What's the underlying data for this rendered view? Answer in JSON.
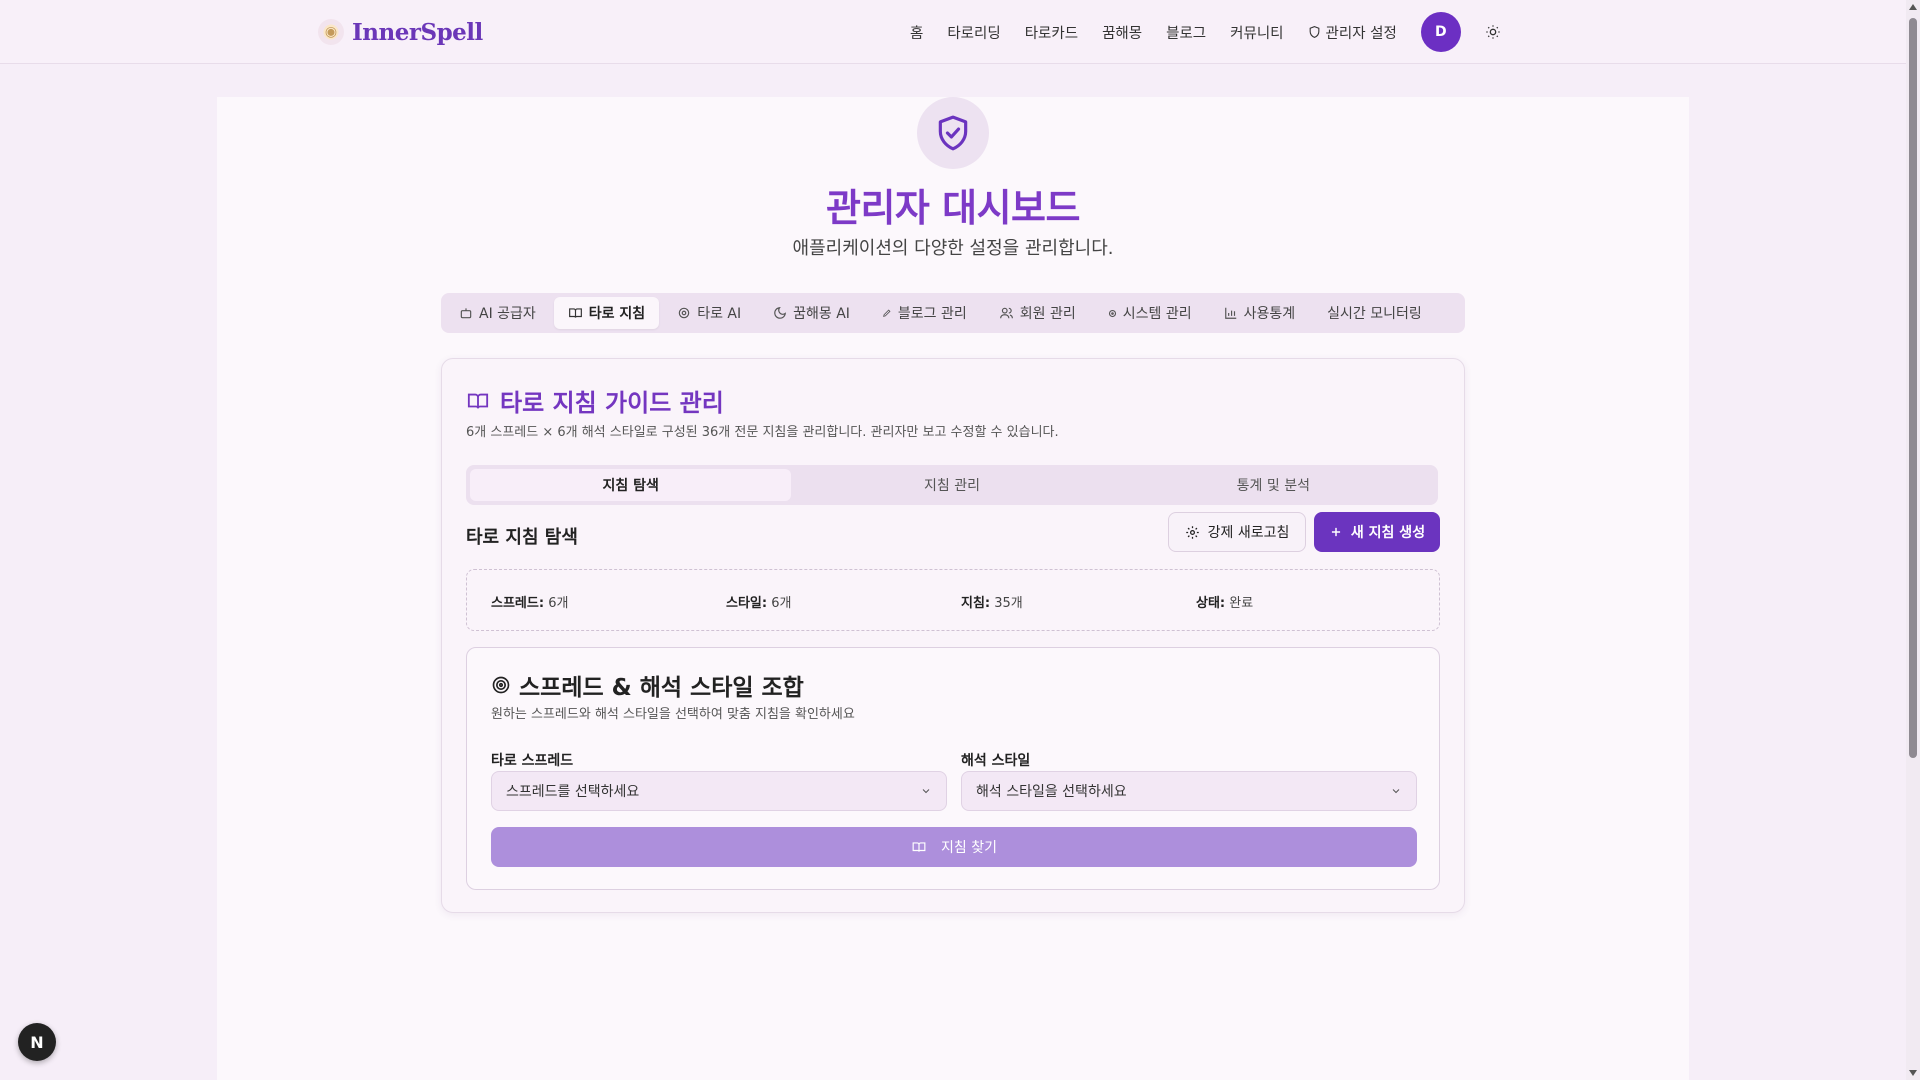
{
  "header": {
    "brand": "InnerSpell",
    "nav": [
      {
        "label": "홈"
      },
      {
        "label": "타로리딩"
      },
      {
        "label": "타로카드"
      },
      {
        "label": "꿈해몽"
      },
      {
        "label": "블로그"
      },
      {
        "label": "커뮤니티"
      },
      {
        "label": "관리자 설정"
      }
    ],
    "avatar_initial": "D"
  },
  "page": {
    "title": "관리자 대시보드",
    "subtitle": "애플리케이션의 다양한 설정을 관리합니다."
  },
  "tabs": [
    {
      "label": "AI 공급자",
      "icon": "bot-icon"
    },
    {
      "label": "타로 지침",
      "icon": "book-icon",
      "active": true
    },
    {
      "label": "타로 AI",
      "icon": "gear-icon"
    },
    {
      "label": "꿈해몽 AI",
      "icon": "moon-icon"
    },
    {
      "label": "블로그 관리",
      "icon": "pen-icon"
    },
    {
      "label": "회원 관리",
      "icon": "users-icon"
    },
    {
      "label": "시스템 관리",
      "icon": "circle-icon"
    },
    {
      "label": "사용통계",
      "icon": "chart-icon"
    },
    {
      "label": "실시간 모니터링",
      "icon": ""
    }
  ],
  "card": {
    "title": "타로 지침 가이드 관리",
    "description": "6개 스프레드 × 6개 해석 스타일로 구성된 36개 전문 지침을 관리합니다. 관리자만 보고 수정할 수 있습니다.",
    "subtabs": [
      {
        "label": "지침 탐색",
        "active": true
      },
      {
        "label": "지침 관리"
      },
      {
        "label": "통계 및 분석"
      }
    ],
    "section_title": "타로 지침 탐색",
    "refresh_label": "강제 새로고침",
    "create_label": "새 지침 생성",
    "stats": [
      {
        "key": "스프레드:",
        "value": "6개"
      },
      {
        "key": "스타일:",
        "value": "6개"
      },
      {
        "key": "지침:",
        "value": "35개"
      },
      {
        "key": "상태:",
        "value": "완료"
      }
    ],
    "combo": {
      "title": "스프레드 & 해석 스타일 조합",
      "description": "원하는 스프레드와 해석 스타일을 선택하여 맞춤 지침을 확인하세요",
      "spread_label": "타로 스프레드",
      "spread_placeholder": "스프레드를 선택하세요",
      "style_label": "해석 스타일",
      "style_placeholder": "해석 스타일을 선택하세요",
      "find_label": "지침 찾기"
    }
  },
  "floating_badge": "N",
  "colors": {
    "accent": "#6b34bf",
    "title": "#7d3ac7",
    "background": "#f6eef8"
  }
}
